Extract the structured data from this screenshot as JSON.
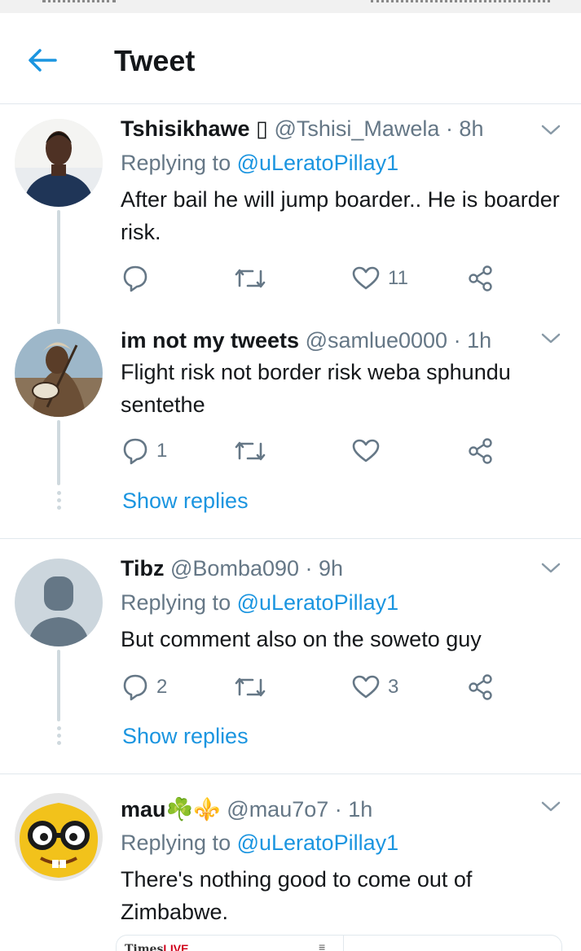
{
  "header": {
    "title": "Tweet"
  },
  "tweets": [
    {
      "name": "Tshisikhawe ▯",
      "handle": "@Tshisi_Mawela",
      "time": "· 8h",
      "replying_prefix": "Replying to ",
      "replying_handle": "@uLeratoPillay1",
      "text": "After bail he will jump boarder.. He is boarder risk.",
      "replies": "",
      "retweets": "",
      "likes": "11"
    },
    {
      "name": "im not my tweets",
      "handle": "@samlue0000",
      "time": "· 1h",
      "text": "Flight risk not border risk weba sphundu sentethe",
      "replies": "1",
      "retweets": "",
      "likes": "",
      "show_replies": "Show replies"
    },
    {
      "name": "Tibz",
      "handle": "@Bomba090",
      "time": "· 9h",
      "replying_prefix": "Replying to ",
      "replying_handle": "@uLeratoPillay1",
      "text": "But comment also on the soweto guy",
      "replies": "2",
      "retweets": "",
      "likes": "3",
      "show_replies": "Show replies"
    },
    {
      "name": "mau☘️⚜️",
      "handle": "@mau7o7",
      "time": "· 1h",
      "replying_prefix": "Replying to ",
      "replying_handle": "@uLeratoPillay1",
      "text": "There's nothing good to come out of Zimbabwe."
    }
  ],
  "card": {
    "logo_main": "Times",
    "logo_accent": "LIVE",
    "menu": "≡"
  },
  "icons": {
    "back": "arrow-left-icon",
    "caret": "chevron-down-icon",
    "reply": "reply-bubble-icon",
    "retweet": "retweet-icon",
    "like": "heart-icon",
    "share": "share-icon"
  },
  "colors": {
    "accent": "#1b95e0",
    "muted": "#657786",
    "text": "#14171a",
    "border": "#e1e8ed"
  }
}
